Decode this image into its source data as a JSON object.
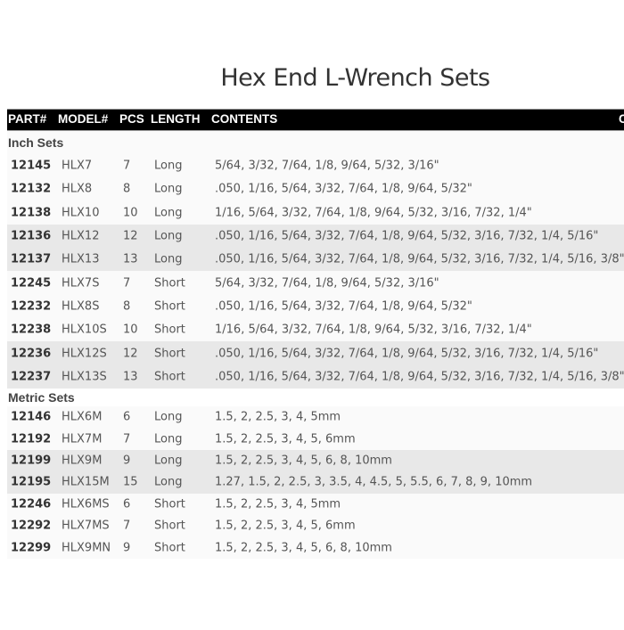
{
  "title": "Hex End L-Wrench Sets",
  "header": {
    "part": "PART#",
    "model": "MODEL#",
    "pcs": "PCS",
    "length": "LENGTH",
    "contents": "CONTENTS",
    "extra": "C"
  },
  "inch": {
    "label": "Inch Sets",
    "rows": [
      {
        "part": "12145",
        "model": "HLX7",
        "pcs": "7",
        "length": "Long",
        "contents": "5/64, 3/32, 7/64, 1/8, 9/64, 5/32, 3/16\""
      },
      {
        "part": "12132",
        "model": "HLX8",
        "pcs": "8",
        "length": "Long",
        "contents": ".050, 1/16, 5/64, 3/32, 7/64, 1/8, 9/64, 5/32\""
      },
      {
        "part": "12138",
        "model": "HLX10",
        "pcs": "10",
        "length": "Long",
        "contents": "1/16, 5/64, 3/32, 7/64, 1/8, 9/64, 5/32, 3/16, 7/32, 1/4\""
      },
      {
        "part": "12136",
        "model": "HLX12",
        "pcs": "12",
        "length": "Long",
        "contents": ".050, 1/16, 5/64, 3/32, 7/64, 1/8, 9/64, 5/32, 3/16, 7/32, 1/4, 5/16\""
      },
      {
        "part": "12137",
        "model": "HLX13",
        "pcs": "13",
        "length": "Long",
        "contents": ".050, 1/16, 5/64, 3/32, 7/64, 1/8, 9/64, 5/32, 3/16, 7/32, 1/4, 5/16, 3/8\""
      },
      {
        "part": "12245",
        "model": "HLX7S",
        "pcs": "7",
        "length": "Short",
        "contents": "5/64, 3/32, 7/64, 1/8, 9/64, 5/32, 3/16\""
      },
      {
        "part": "12232",
        "model": "HLX8S",
        "pcs": "8",
        "length": "Short",
        "contents": ".050, 1/16, 5/64, 3/32, 7/64, 1/8, 9/64, 5/32\""
      },
      {
        "part": "12238",
        "model": "HLX10S",
        "pcs": "10",
        "length": "Short",
        "contents": "1/16, 5/64, 3/32, 7/64, 1/8, 9/64, 5/32, 3/16, 7/32, 1/4\""
      },
      {
        "part": "12236",
        "model": "HLX12S",
        "pcs": "12",
        "length": "Short",
        "contents": ".050, 1/16, 5/64, 3/32, 7/64, 1/8, 9/64, 5/32, 3/16, 7/32, 1/4, 5/16\""
      },
      {
        "part": "12237",
        "model": "HLX13S",
        "pcs": "13",
        "length": "Short",
        "contents": ".050, 1/16, 5/64, 3/32, 7/64, 1/8, 9/64, 5/32, 3/16, 7/32, 1/4, 5/16, 3/8\""
      }
    ]
  },
  "metric": {
    "label": "Metric Sets",
    "rows": [
      {
        "part": "12146",
        "model": "HLX6M",
        "pcs": "6",
        "length": "Long",
        "contents": "1.5, 2, 2.5, 3, 4, 5mm"
      },
      {
        "part": "12192",
        "model": "HLX7M",
        "pcs": "7",
        "length": "Long",
        "contents": "1.5, 2, 2.5, 3, 4, 5, 6mm"
      },
      {
        "part": "12199",
        "model": "HLX9M",
        "pcs": "9",
        "length": "Long",
        "contents": "1.5, 2, 2.5, 3, 4, 5, 6, 8, 10mm"
      },
      {
        "part": "12195",
        "model": "HLX15M",
        "pcs": "15",
        "length": "Long",
        "contents": "1.27, 1.5, 2, 2.5, 3, 3.5, 4, 4.5, 5, 5.5, 6, 7, 8, 9, 10mm"
      },
      {
        "part": "12246",
        "model": "HLX6MS",
        "pcs": "6",
        "length": "Short",
        "contents": "1.5, 2, 2.5, 3, 4, 5mm"
      },
      {
        "part": "12292",
        "model": "HLX7MS",
        "pcs": "7",
        "length": "Short",
        "contents": "1.5, 2, 2.5, 3, 4, 5, 6mm"
      },
      {
        "part": "12299",
        "model": "HLX9MN",
        "pcs": "9",
        "length": "Short",
        "contents": "1.5, 2, 2.5, 3, 4, 5, 6, 8, 10mm"
      }
    ]
  }
}
